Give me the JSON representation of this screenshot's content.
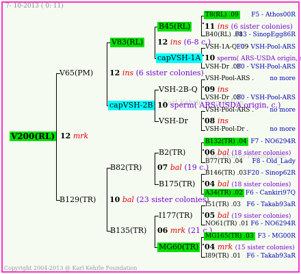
{
  "meta": {
    "date": "7- 10-2013 ( 0: 11)",
    "copyright": "Copyright 2004-2013 @ Karl Kehrle Foundation",
    "watermark": "Karl Kehrle Foundation"
  },
  "colors": {
    "highlight_green": "#00e000",
    "highlight_cyan": "#00ffff",
    "border": "#ff33cc",
    "mating_red": "#e00000",
    "sisters_purple": "#7b00d0",
    "ref_blue": "#0000b0"
  },
  "root": {
    "name": "V200(RL)",
    "year": "12",
    "mating": "mrk"
  },
  "gen1": [
    {
      "name": "V65(PM)",
      "year": "12",
      "mating": "ins",
      "sisters": "(6 sister colonies)"
    },
    {
      "name": "B129(TR)",
      "year": "10",
      "mating": "bal",
      "sisters": "(23 sister colonies)"
    }
  ],
  "gen2": [
    {
      "name": "V83(RL)",
      "year": "12",
      "mating": "ins",
      "sisters": "(6-8 c.)"
    },
    {
      "name": "capVSH-2B",
      "year": "10",
      "mating": "sperm( ARS-USDA origin, c.)"
    },
    {
      "name": "B82(TR)",
      "year": "07",
      "mating": "bal",
      "sisters": "(19 c.)"
    },
    {
      "name": "B135(TR)",
      "year": "06",
      "mating": "mrk",
      "sisters": "(21 c.)"
    }
  ],
  "gen3": [
    {
      "name": "B45(RL)",
      "year": "11",
      "mating": "ins",
      "sisters": "(6 sister colonies)"
    },
    {
      "name": "capVSH-1A",
      "year": "10",
      "mating": "sperm( ARS-USDA origin, sister colonies)"
    },
    {
      "name": "VSH-2B-Q",
      "year": "09",
      "mating": "ins"
    },
    {
      "name": "VSH-Dr",
      "year": "08",
      "mating": "ins"
    },
    {
      "name": "B2(TR)",
      "year": "06",
      "mating": "bal",
      "sisters": "(18 sister colonies)"
    },
    {
      "name": "B175(TR)",
      "year": "04",
      "mating": "bal",
      "sisters": "(18 sister colonies)"
    },
    {
      "name": "I177(TR)",
      "year": "05",
      "mating": "bal",
      "sisters": "(19 sister colonies)"
    },
    {
      "name": "MG60(TR)",
      "year": "04",
      "mating": "mrk",
      "sisters": "(15 sister colonies)"
    }
  ],
  "gen4": [
    {
      "name": "T8(RL) .09",
      "ref": "F5 - Athos00R",
      "hl": "g"
    },
    {
      "name": "B40(RL) .08",
      "ref": "F13 - SinopEgg86R",
      "hl": ""
    },
    {
      "name": "VSH-1A-Q .09",
      "ref": "F0 - VSH-Pool-ARS",
      "hl": ""
    },
    {
      "name": "VSH-Dr .08",
      "ref": "F0 - VSH-Pool-ARS",
      "hl": ""
    },
    {
      "name": "VSH-Pool-ARS .",
      "ref": "no more",
      "hl": ""
    },
    {
      "name": "VSH-Dr .08",
      "ref": "F0 - VSH-Pool-ARS",
      "hl": ""
    },
    {
      "name": "VSH-Pool-ARS .",
      "ref": "no more",
      "hl": ""
    },
    {
      "name": "VSH-Pool-Dr .",
      "ref": "no more",
      "hl": ""
    },
    {
      "name": "B132(TR) .04",
      "ref": "F7 - NO6294R",
      "hl": "g"
    },
    {
      "name": "B77(TR) .04",
      "ref": "F8 - Old_Lady",
      "hl": ""
    },
    {
      "name": "B146(TR) .03",
      "ref": "F20 - Sinop62R",
      "hl": ""
    },
    {
      "name": "A34(TR) .02",
      "ref": "F6 - Cankiri97Q",
      "hl": "g"
    },
    {
      "name": "I51(TR) .03",
      "ref": "F6 - Takab93aR",
      "hl": ""
    },
    {
      "name": "NO61(TR) .01",
      "ref": "F6 - NO6294R",
      "hl": ""
    },
    {
      "name": "MG165(TR) .03",
      "ref": "F3 - MG00R",
      "hl": "g"
    },
    {
      "name": "I89(TR) .01",
      "ref": "F6 - Takab93aR",
      "hl": ""
    }
  ]
}
